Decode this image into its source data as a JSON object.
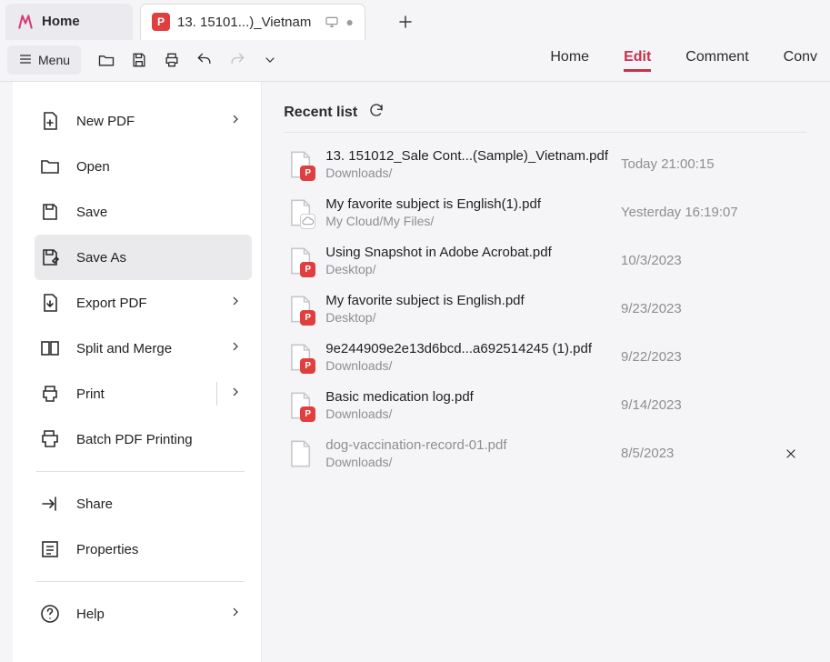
{
  "tabs": {
    "home_label": "Home",
    "doc_label": "13. 15101...)_Vietnam"
  },
  "menu_button": "Menu",
  "ribbon": {
    "home": "Home",
    "edit": "Edit",
    "comment": "Comment",
    "convert": "Conv"
  },
  "left_menu": {
    "new_pdf": "New PDF",
    "open": "Open",
    "save": "Save",
    "save_as": "Save As",
    "export_pdf": "Export PDF",
    "split_merge": "Split and Merge",
    "print": "Print",
    "batch_print": "Batch PDF Printing",
    "share": "Share",
    "properties": "Properties",
    "help": "Help"
  },
  "recent": {
    "title": "Recent list",
    "items": [
      {
        "name": "13. 151012_Sale Cont...(Sample)_Vietnam.pdf",
        "path": "Downloads/",
        "date": "Today 21:00:15",
        "badge": "pdf",
        "dim": false,
        "close": false
      },
      {
        "name": "My favorite subject is English(1).pdf",
        "path": "My Cloud/My Files/",
        "date": "Yesterday 16:19:07",
        "badge": "cloud",
        "dim": false,
        "close": false
      },
      {
        "name": "Using Snapshot in Adobe Acrobat.pdf",
        "path": "Desktop/",
        "date": "10/3/2023",
        "badge": "pdf",
        "dim": false,
        "close": false
      },
      {
        "name": "My favorite subject is English.pdf",
        "path": "Desktop/",
        "date": "9/23/2023",
        "badge": "pdf",
        "dim": false,
        "close": false
      },
      {
        "name": "9e244909e2e13d6bcd...a692514245 (1).pdf",
        "path": "Downloads/",
        "date": "9/22/2023",
        "badge": "pdf",
        "dim": false,
        "close": false
      },
      {
        "name": "Basic medication log.pdf",
        "path": "Downloads/",
        "date": "9/14/2023",
        "badge": "pdf",
        "dim": false,
        "close": false
      },
      {
        "name": "dog-vaccination-record-01.pdf",
        "path": "Downloads/",
        "date": "8/5/2023",
        "badge": "none",
        "dim": true,
        "close": true
      }
    ]
  }
}
